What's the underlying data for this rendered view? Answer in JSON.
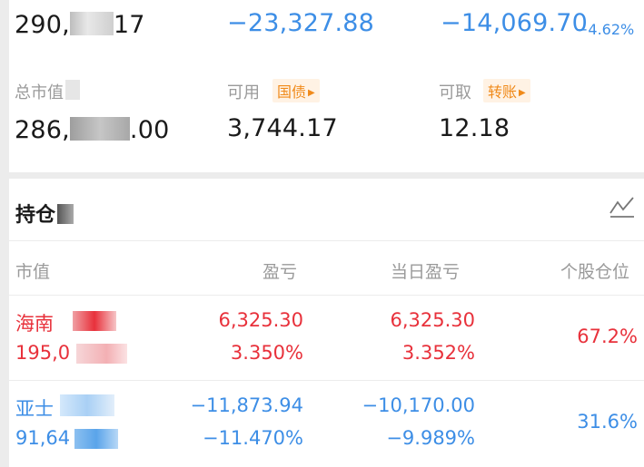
{
  "summary": {
    "total_assets": "290,",
    "total_assets_tail": "17",
    "total_pnl": "−23,327.88",
    "today_pnl": "−14,069.70",
    "today_pnl_pct": "−4.62%"
  },
  "account": {
    "market_value_label": "总市值",
    "market_value_prefix": "286,",
    "market_value_suffix": ".00",
    "available_label": "可用",
    "available_tag": "国债",
    "available_value": "3,744.17",
    "withdrawable_label": "可取",
    "withdrawable_tag": "转账",
    "withdrawable_value": "12.18"
  },
  "holdings": {
    "title": "持仓",
    "columns": [
      "市值",
      "盈亏",
      "当日盈亏",
      "个股仓位"
    ],
    "rows": [
      {
        "name": "海南",
        "value": "195,0",
        "pnl": "6,325.30",
        "pnl_pct": "3.350%",
        "today_pnl": "6,325.30",
        "today_pnl_pct": "3.352%",
        "weight": "67.2%",
        "color": "#e8313b"
      },
      {
        "name": "亚士",
        "value": "91,64",
        "pnl": "−11,873.94",
        "pnl_pct": "−11.470%",
        "today_pnl": "−10,170.00",
        "today_pnl_pct": "−9.989%",
        "weight": "31.6%",
        "color": "#3d8ee6"
      }
    ]
  },
  "colors": {
    "up": "#e8313b",
    "down": "#3d8ee6",
    "accent": "#f08a1a"
  }
}
